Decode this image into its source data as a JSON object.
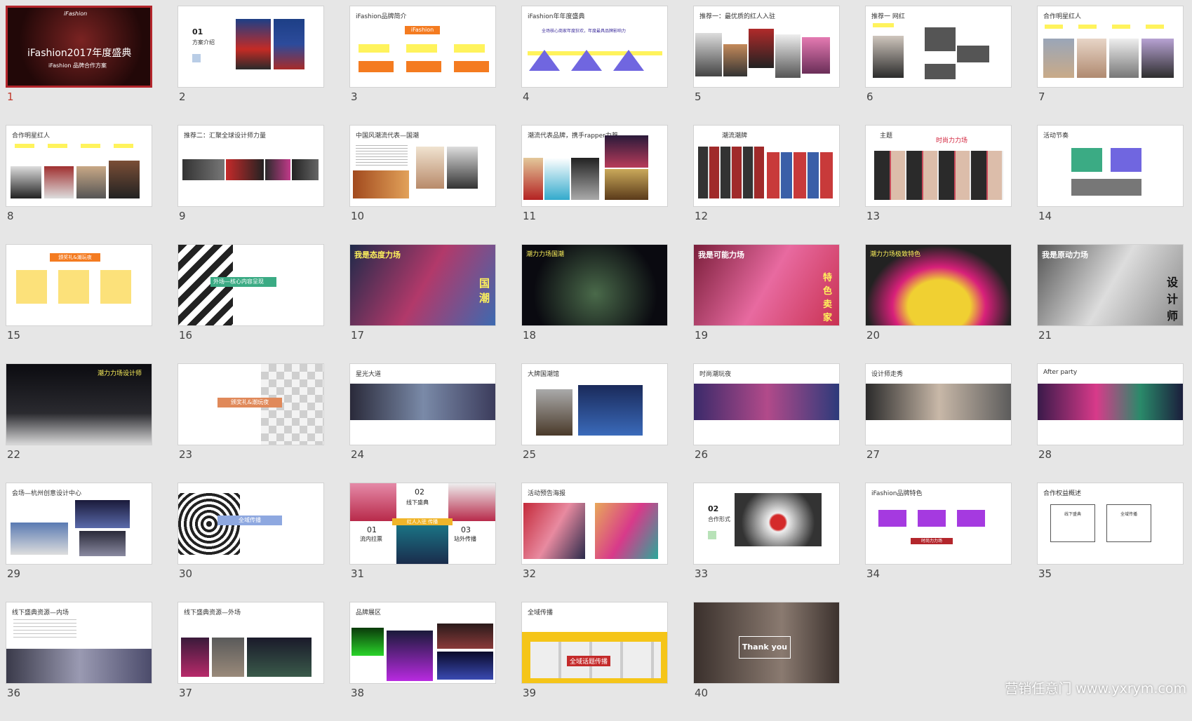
{
  "watermark": "营销任意门 www.yxrym.com",
  "slides": [
    {
      "n": "1",
      "title": "iFashion2017年度盛典",
      "sub": "iFashion 品牌合作方案",
      "logo": "iFashion"
    },
    {
      "n": "2",
      "title": "01",
      "sub": "方案介绍"
    },
    {
      "n": "3",
      "title": "iFashion品牌简介",
      "tag": "iFashion"
    },
    {
      "n": "4",
      "title": "iFashion年年度盛典",
      "sub": "全场核心商家年度狂欢，年度最具品牌影响力"
    },
    {
      "n": "5",
      "title": "推荐一：最优质的红人入驻"
    },
    {
      "n": "6",
      "title": "推荐一 网红"
    },
    {
      "n": "7",
      "title": "合作明星红人"
    },
    {
      "n": "8",
      "title": "合作明星红人"
    },
    {
      "n": "9",
      "title": "推荐二：汇聚全球设计师力量"
    },
    {
      "n": "10",
      "title": "中国风潮流代表—国潮"
    },
    {
      "n": "11",
      "title": "潮流代表品牌，携手rapper力荐"
    },
    {
      "n": "12",
      "title": "潮流潮牌"
    },
    {
      "n": "13",
      "title": "主题",
      "sub": "时尚力力场"
    },
    {
      "n": "14",
      "title": "活动节奏"
    },
    {
      "n": "15",
      "title": "颁奖礼&潮玩夜"
    },
    {
      "n": "16",
      "title": "外场—核心内容呈现"
    },
    {
      "n": "17",
      "title": "我是态度力场",
      "side": "国潮"
    },
    {
      "n": "18",
      "title": "潮力力场国潮"
    },
    {
      "n": "19",
      "title": "我是可能力场",
      "side": "特色卖家"
    },
    {
      "n": "20",
      "title": "潮力力场极致特色"
    },
    {
      "n": "21",
      "title": "我是原动力场",
      "side": "设计师"
    },
    {
      "n": "22",
      "title": "潮力力场设计师"
    },
    {
      "n": "23",
      "title": "颁奖礼&潮玩夜"
    },
    {
      "n": "24",
      "title": "星光大道"
    },
    {
      "n": "25",
      "title": "大牌国潮馆"
    },
    {
      "n": "26",
      "title": "时尚潮玩夜"
    },
    {
      "n": "27",
      "title": "设计师走秀"
    },
    {
      "n": "28",
      "title": "After party"
    },
    {
      "n": "29",
      "title": "会场—杭州创意设计中心"
    },
    {
      "n": "30",
      "title": "全域传播"
    },
    {
      "n": "31",
      "title": "线下盛典",
      "a": "01",
      "b": "02",
      "c": "03",
      "la": "流内拉票",
      "lc": "站外传播",
      "lm": "红人入驻 传播"
    },
    {
      "n": "32",
      "title": "活动预告海报"
    },
    {
      "n": "33",
      "title": "02",
      "sub": "合作形式"
    },
    {
      "n": "34",
      "title": "iFashion品牌特色",
      "sub": "时尚力力场"
    },
    {
      "n": "35",
      "title": "合作权益概述",
      "a": "线下盛典",
      "b": "全域传播"
    },
    {
      "n": "36",
      "title": "线下盛典资源—内场"
    },
    {
      "n": "37",
      "title": "线下盛典资源—外场"
    },
    {
      "n": "38",
      "title": "品牌展区"
    },
    {
      "n": "39",
      "title": "全域传播",
      "sub": "全域话题传播"
    },
    {
      "n": "40",
      "title": "Thank you"
    }
  ],
  "colors": {
    "selected_border": "#b3262c",
    "purple": "#7066e0",
    "orange": "#f47b20",
    "yellow": "#fff35c",
    "green": "#3bab84"
  }
}
